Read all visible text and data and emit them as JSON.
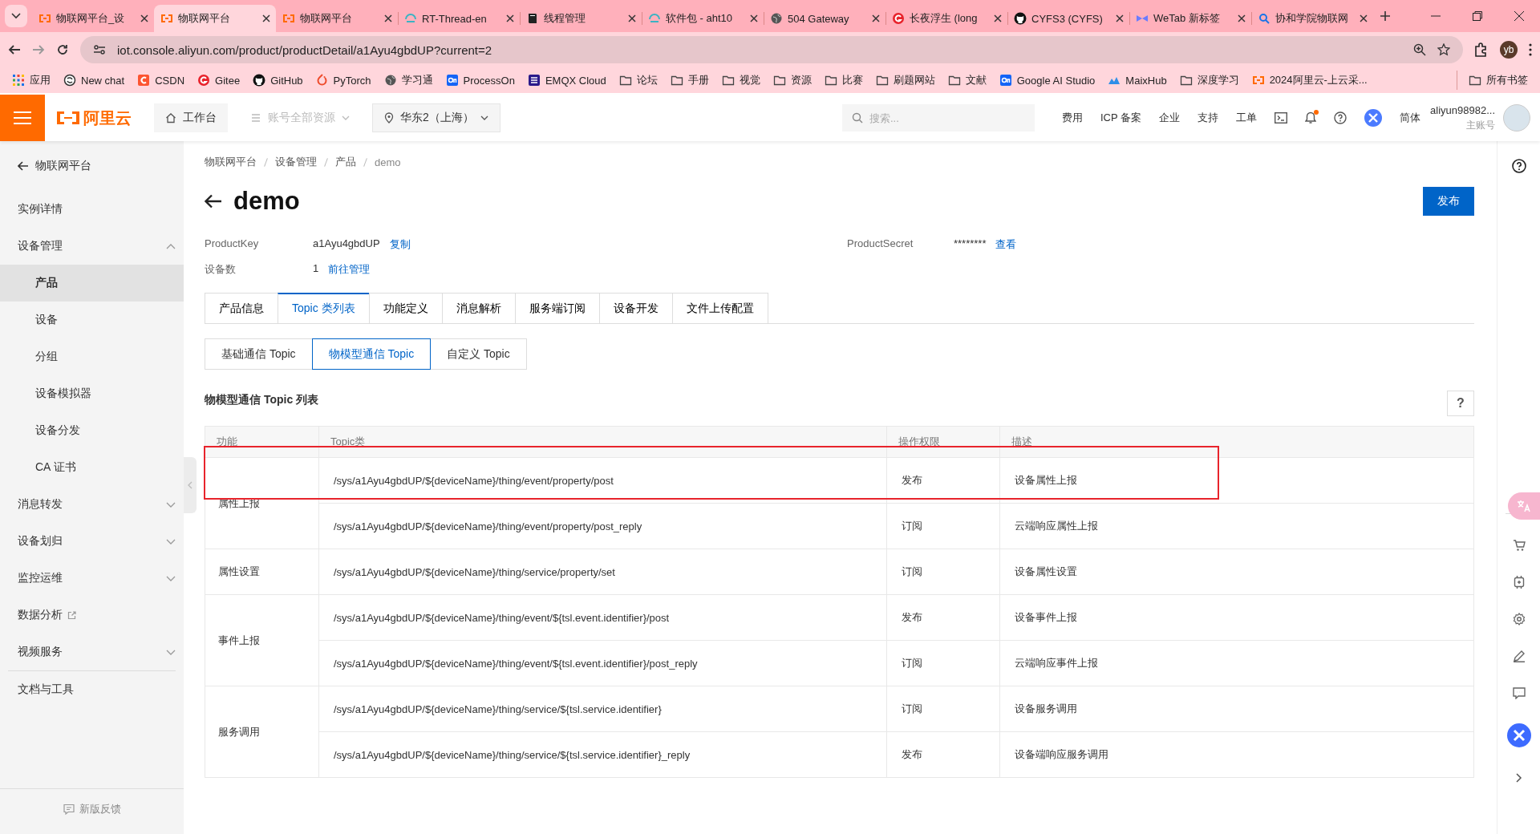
{
  "browser": {
    "tabs": [
      {
        "title": "物联网平台_设",
        "selected": false
      },
      {
        "title": "物联网平台",
        "selected": true
      },
      {
        "title": "物联网平台",
        "selected": false
      },
      {
        "title": "RT-Thread-en",
        "selected": false
      },
      {
        "title": "线程管理",
        "selected": false
      },
      {
        "title": "软件包 - aht10",
        "selected": false
      },
      {
        "title": "504 Gateway",
        "selected": false
      },
      {
        "title": "长夜浮生 (long",
        "selected": false
      },
      {
        "title": "CYFS3 (CYFS)",
        "selected": false
      },
      {
        "title": "WeTab 新标签",
        "selected": false
      },
      {
        "title": "协和学院物联网",
        "selected": false
      }
    ],
    "address": "iot.console.aliyun.com/product/productDetail/a1Ayu4gbdUP?current=2",
    "profile": "yb",
    "bookmarks": [
      "应用",
      "New chat",
      "CSDN",
      "Gitee",
      "GitHub",
      "PyTorch",
      "学习通",
      "ProcessOn",
      "EMQX Cloud",
      "论坛",
      "手册",
      "视觉",
      "资源",
      "比赛",
      "刷题网站",
      "文献",
      "Google AI Studio",
      "MaixHub",
      "深度学习",
      "2024阿里云-上云采..."
    ],
    "all_bookmarks": "所有书签"
  },
  "console": {
    "logo": "阿里云",
    "workbench": "工作台",
    "account_scope": {
      "label": "账号全部资源",
      "disabled": true
    },
    "region": "华东2（上海）",
    "search": {
      "placeholder": "搜索..."
    },
    "links": [
      "费用",
      "ICP 备案",
      "企业",
      "支持",
      "工单"
    ],
    "notifications": {
      "unread": true
    },
    "language": "简体",
    "user": {
      "name": "aliyun98982...",
      "role": "主账号"
    }
  },
  "sidebar": {
    "back": "物联网平台",
    "sections": [
      [
        {
          "label": "实例详情",
          "kind": "link",
          "selected": false
        },
        {
          "label": "设备管理",
          "kind": "group",
          "expanded": true,
          "selected": false,
          "children": [
            {
              "label": "产品",
              "selected": true
            },
            {
              "label": "设备",
              "selected": false
            },
            {
              "label": "分组",
              "selected": false
            },
            {
              "label": "设备模拟器",
              "selected": false
            },
            {
              "label": "设备分发",
              "selected": false
            },
            {
              "label": "CA 证书",
              "selected": false
            }
          ]
        },
        {
          "label": "消息转发",
          "kind": "group",
          "expanded": false,
          "selected": false
        },
        {
          "label": "设备划归",
          "kind": "group",
          "expanded": false,
          "selected": false
        },
        {
          "label": "监控运维",
          "kind": "group",
          "expanded": false,
          "selected": false
        },
        {
          "label": "数据分析",
          "kind": "external",
          "selected": false
        },
        {
          "label": "视频服务",
          "kind": "group",
          "expanded": false,
          "selected": false
        }
      ],
      [
        {
          "label": "文档与工具",
          "kind": "link",
          "selected": false
        }
      ]
    ],
    "feedback": "新版反馈"
  },
  "page": {
    "breadcrumbs": [
      "物联网平台",
      "设备管理",
      "产品",
      "demo"
    ],
    "title": "demo",
    "publish": "发布",
    "info": [
      {
        "label": "ProductKey",
        "value": "a1Ayu4gbdUP",
        "action": "复制"
      },
      {
        "label": "ProductSecret",
        "value": "********",
        "action": "查看"
      },
      {
        "label": "设备数",
        "value": "1",
        "action": "前往管理"
      }
    ],
    "tabs": [
      {
        "label": "产品信息",
        "selected": false
      },
      {
        "label": "Topic 类列表",
        "selected": true
      },
      {
        "label": "功能定义",
        "selected": false
      },
      {
        "label": "消息解析",
        "selected": false
      },
      {
        "label": "服务端订阅",
        "selected": false
      },
      {
        "label": "设备开发",
        "selected": false
      },
      {
        "label": "文件上传配置",
        "selected": false
      }
    ],
    "subtabs": [
      {
        "label": "基础通信 Topic",
        "selected": false
      },
      {
        "label": "物模型通信 Topic",
        "selected": true
      },
      {
        "label": "自定义 Topic",
        "selected": false
      }
    ],
    "section_title": "物模型通信 Topic 列表",
    "help": "?",
    "table": {
      "columns": [
        "功能",
        "Topic类",
        "操作权限",
        "描述"
      ],
      "groups": [
        {
          "function": "属性上报",
          "rows": [
            {
              "topic": "/sys/a1Ayu4gbdUP/${deviceName}/thing/event/property/post",
              "permission": "发布",
              "description": "设备属性上报",
              "highlighted": true
            },
            {
              "topic": "/sys/a1Ayu4gbdUP/${deviceName}/thing/event/property/post_reply",
              "permission": "订阅",
              "description": "云端响应属性上报",
              "highlighted": false
            }
          ]
        },
        {
          "function": "属性设置",
          "rows": [
            {
              "topic": "/sys/a1Ayu4gbdUP/${deviceName}/thing/service/property/set",
              "permission": "订阅",
              "description": "设备属性设置",
              "highlighted": false
            }
          ]
        },
        {
          "function": "事件上报",
          "rows": [
            {
              "topic": "/sys/a1Ayu4gbdUP/${deviceName}/thing/event/${tsl.event.identifier}/post",
              "permission": "发布",
              "description": "设备事件上报",
              "highlighted": false
            },
            {
              "topic": "/sys/a1Ayu4gbdUP/${deviceName}/thing/event/${tsl.event.identifier}/post_reply",
              "permission": "订阅",
              "description": "云端响应事件上报",
              "highlighted": false
            }
          ]
        },
        {
          "function": "服务调用",
          "rows": [
            {
              "topic": "/sys/a1Ayu4gbdUP/${deviceName}/thing/service/${tsl.service.identifier}",
              "permission": "订阅",
              "description": "设备服务调用",
              "highlighted": false
            },
            {
              "topic": "/sys/a1Ayu4gbdUP/${deviceName}/thing/service/${tsl.service.identifier}_reply",
              "permission": "发布",
              "description": "设备端响应服务调用",
              "highlighted": false
            }
          ]
        }
      ]
    }
  }
}
